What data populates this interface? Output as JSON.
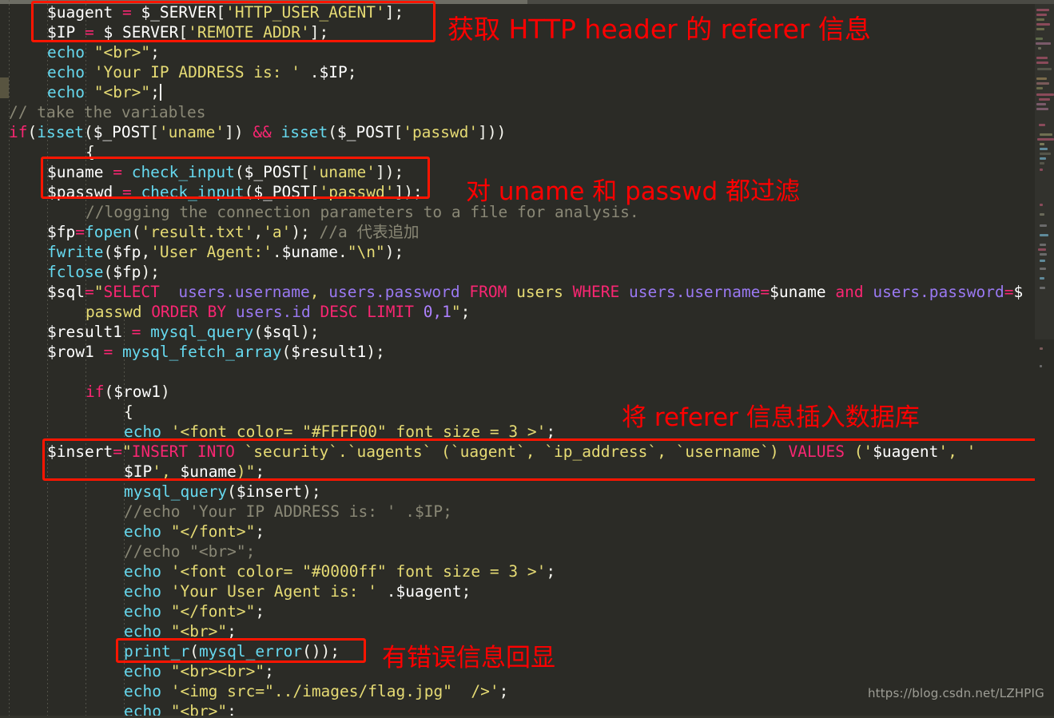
{
  "editor": {
    "language": "php",
    "theme": "monokai-dark",
    "background_color": "#2b2b26",
    "annotation_color": "#ff0000",
    "box_color": "#ff1500"
  },
  "code_lines": [
    {
      "n": 1,
      "indent": 3,
      "text": "$uagent = $_SERVER['HTTP_USER_AGENT'];"
    },
    {
      "n": 2,
      "indent": 3,
      "text": "$IP = $_SERVER['REMOTE_ADDR'];"
    },
    {
      "n": 3,
      "indent": 3,
      "text": "echo \"<br>\";"
    },
    {
      "n": 4,
      "indent": 3,
      "text": "echo 'Your IP ADDRESS is: ' .$IP;"
    },
    {
      "n": 5,
      "indent": 3,
      "text": "echo \"<br>\";"
    },
    {
      "n": 6,
      "indent": 0,
      "text": "// take the variables"
    },
    {
      "n": 7,
      "indent": 0,
      "text": "if(isset($_POST['uname']) && isset($_POST['passwd']))"
    },
    {
      "n": 8,
      "indent": 4,
      "text": "{"
    },
    {
      "n": 9,
      "indent": 3,
      "text": "$uname = check_input($_POST['uname']);"
    },
    {
      "n": 10,
      "indent": 3,
      "text": "$passwd = check_input($_POST['passwd']);"
    },
    {
      "n": 11,
      "indent": 5,
      "text": "//logging the connection parameters to a file for analysis."
    },
    {
      "n": 12,
      "indent": 3,
      "text": "$fp=fopen('result.txt','a'); //a 代表追加"
    },
    {
      "n": 13,
      "indent": 3,
      "text": "fwrite($fp,'User Agent:'.$uname.\"\\n\");"
    },
    {
      "n": 14,
      "indent": 3,
      "text": "fclose($fp);"
    },
    {
      "n": 15,
      "indent": 3,
      "text": "$sql=\"SELECT  users.username, users.password FROM users WHERE users.username=$uname and users.password=$"
    },
    {
      "n": 16,
      "indent": 7,
      "text": "passwd ORDER BY users.id DESC LIMIT 0,1\";"
    },
    {
      "n": 17,
      "indent": 3,
      "text": "$result1 = mysql_query($sql);"
    },
    {
      "n": 18,
      "indent": 3,
      "text": "$row1 = mysql_fetch_array($result1);"
    },
    {
      "n": 19,
      "indent": 0,
      "text": ""
    },
    {
      "n": 20,
      "indent": 6,
      "text": "if($row1)"
    },
    {
      "n": 21,
      "indent": 8,
      "text": "{"
    },
    {
      "n": 22,
      "indent": 8,
      "text": "echo '<font color= \"#FFFF00\" font size = 3 >';"
    },
    {
      "n": 23,
      "indent": 8,
      "text": "$insert=\"INSERT INTO `security`.`uagents` (`uagent`, `ip_address`, `username`) VALUES ('$uagent', '"
    },
    {
      "n": 24,
      "indent": 11,
      "text": "$IP', $uname)\";"
    },
    {
      "n": 25,
      "indent": 8,
      "text": "mysql_query($insert);"
    },
    {
      "n": 26,
      "indent": 8,
      "text": "//echo 'Your IP ADDRESS is: ' .$IP;"
    },
    {
      "n": 27,
      "indent": 8,
      "text": "echo \"</font>\";"
    },
    {
      "n": 28,
      "indent": 8,
      "text": "//echo \"<br>\";"
    },
    {
      "n": 29,
      "indent": 8,
      "text": "echo '<font color= \"#0000ff\" font size = 3 >';"
    },
    {
      "n": 30,
      "indent": 8,
      "text": "echo 'Your User Agent is: ' .$uagent;"
    },
    {
      "n": 31,
      "indent": 8,
      "text": "echo \"</font>\";"
    },
    {
      "n": 32,
      "indent": 8,
      "text": "echo \"<br>\";"
    },
    {
      "n": 33,
      "indent": 8,
      "text": "print_r(mysql_error());"
    },
    {
      "n": 34,
      "indent": 8,
      "text": "echo \"<br><br>\";"
    },
    {
      "n": 35,
      "indent": 8,
      "text": "echo '<img src=\"../images/flag.jpg\"  />';"
    },
    {
      "n": 36,
      "indent": 8,
      "text": "echo \"<br>\";"
    }
  ],
  "annotations": [
    {
      "id": "anno-1",
      "text": "获取 HTTP header 的 referer 信息"
    },
    {
      "id": "anno-2",
      "text": "对 uname 和 passwd 都过滤"
    },
    {
      "id": "anno-3",
      "text": "将 referer 信息插入数据库"
    },
    {
      "id": "anno-4",
      "text": "有错误信息回显"
    }
  ],
  "highlight_boxes": [
    {
      "id": "box-uagent-ip",
      "label": "server-vars-box"
    },
    {
      "id": "box-check-input",
      "label": "check-input-box"
    },
    {
      "id": "box-insert",
      "label": "insert-statement-box"
    },
    {
      "id": "box-printr",
      "label": "print-error-box"
    }
  ],
  "watermark": {
    "text": "https://blog.csdn.net/LZHPIG"
  }
}
